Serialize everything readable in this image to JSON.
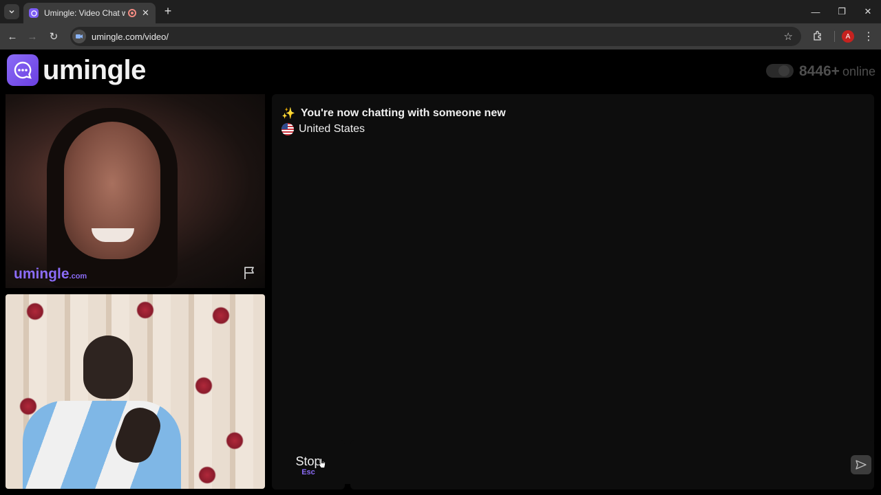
{
  "browser": {
    "tab_title": "Umingle: Video Chat with Strangers",
    "url": "umingle.com/video/",
    "profile_initial": "A"
  },
  "header": {
    "logo_text": "umingle",
    "online_count": "8446+",
    "online_label": "online"
  },
  "stranger_video": {
    "watermark": "umingle",
    "watermark_suffix": ".com"
  },
  "chat": {
    "status_message": "You're now chatting with someone new",
    "country": "United States"
  },
  "controls": {
    "stop_label": "Stop",
    "stop_shortcut": "Esc",
    "message_placeholder": ""
  },
  "colors": {
    "accent": "#8b6cf7",
    "background": "#000000",
    "panel": "#0d0d0d"
  }
}
